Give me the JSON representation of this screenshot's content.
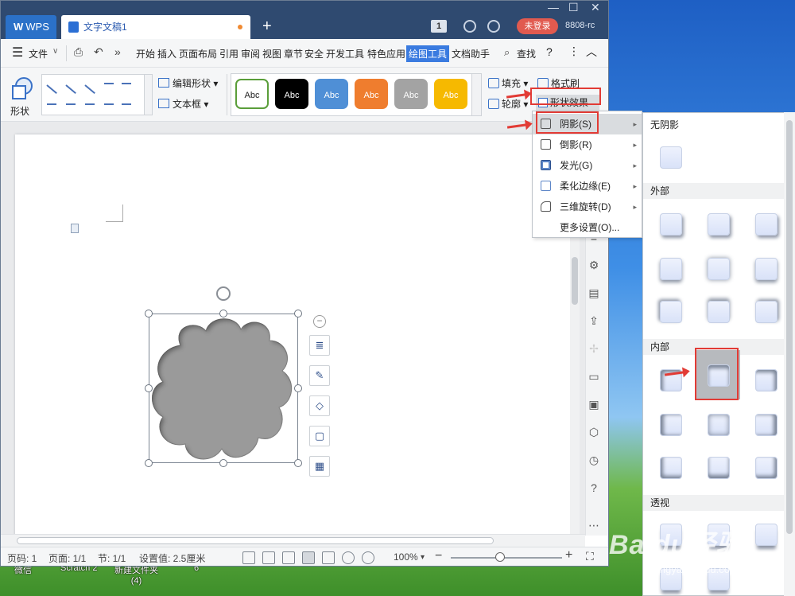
{
  "titlebar": {
    "home_tab": "WPS",
    "doc_tab": "文字文稿1",
    "new_tab": "+",
    "page_badge": "1",
    "login": "未登录",
    "user": "8808-rc"
  },
  "menubar": {
    "file": "文件",
    "items": [
      "开始",
      "插入",
      "页面布局",
      "引用",
      "审阅",
      "视图",
      "章节",
      "安全",
      "开发工具",
      "特色应用",
      "绘图工具",
      "文档助手"
    ],
    "search": "查找",
    "help": "?"
  },
  "ribbon": {
    "shape": "形状",
    "edit_shape": "编辑形状",
    "textbox": "文本框",
    "styles": [
      {
        "label": "Abc",
        "bg": "#ffffff",
        "fg": "#222222",
        "border": "#5a9e3a"
      },
      {
        "label": "Abc",
        "bg": "#000000",
        "fg": "#ffffff",
        "border": "#000000"
      },
      {
        "label": "Abc",
        "bg": "#4f8fd6",
        "fg": "#ffffff",
        "border": "#4f8fd6"
      },
      {
        "label": "Abc",
        "bg": "#ef7d2e",
        "fg": "#ffffff",
        "border": "#ef7d2e"
      },
      {
        "label": "Abc",
        "bg": "#a3a3a3",
        "fg": "#ffffff",
        "border": "#a3a3a3"
      },
      {
        "label": "Abc",
        "bg": "#f6b900",
        "fg": "#ffffff",
        "border": "#f6b900"
      }
    ],
    "fill": "填充",
    "outline": "轮廓",
    "format_painter": "格式刷",
    "shape_effects": "形状效果"
  },
  "dropdown": {
    "items": [
      {
        "label": "阴影(S)",
        "arrow": true
      },
      {
        "label": "倒影(R)",
        "arrow": true
      },
      {
        "label": "发光(G)",
        "arrow": true
      },
      {
        "label": "柔化边缘(E)",
        "arrow": true
      },
      {
        "label": "三维旋转(D)",
        "arrow": true
      },
      {
        "label": "更多设置(O)...",
        "arrow": false
      }
    ]
  },
  "shadow_panel": {
    "no_shadow": "无阴影",
    "outer": "外部",
    "inner": "内部",
    "perspective": "透视"
  },
  "statusbar": {
    "page_num": "页码: 1",
    "pages": "页面: 1/1",
    "section": "节: 1/1",
    "setting": "设置值: 2.5厘米",
    "zoom": "100%",
    "zoom_level": 0.44
  },
  "desktop": {
    "labels": [
      "微信",
      "Scratch 2",
      "新建文件夹\n(4)",
      "6"
    ]
  },
  "watermark": {
    "text": "Baidu经验",
    "url": "jingyan.baidu.com"
  }
}
